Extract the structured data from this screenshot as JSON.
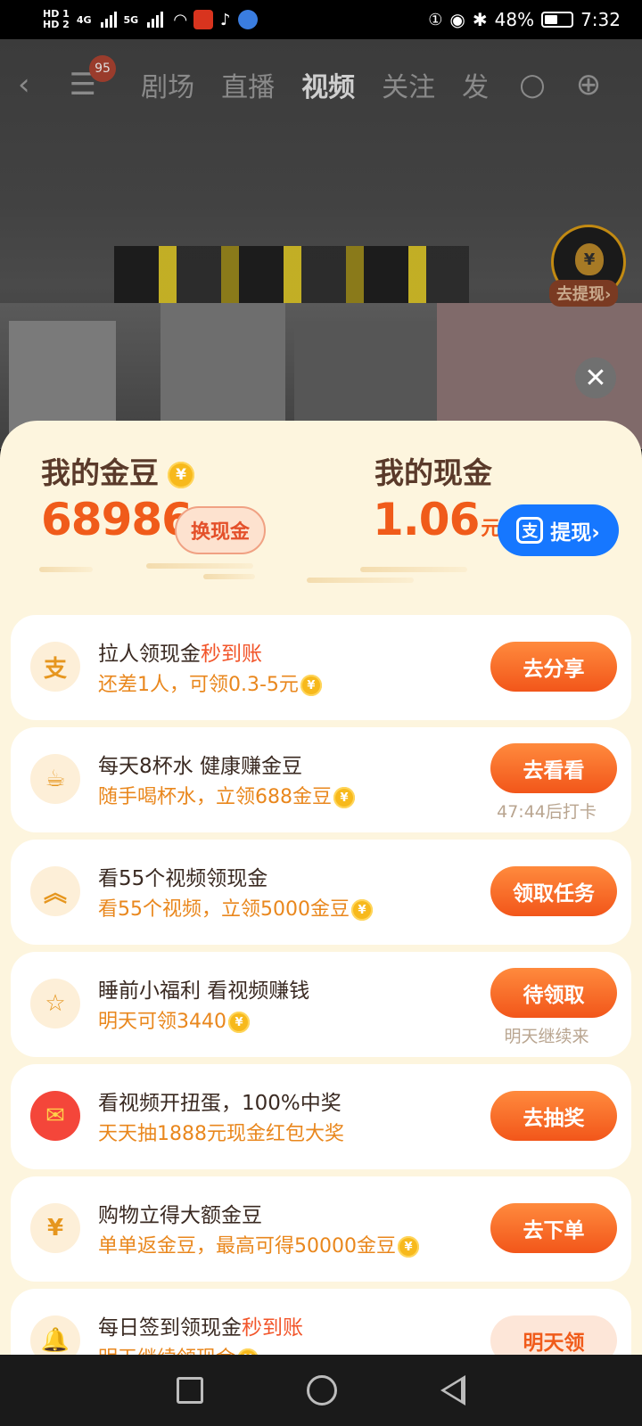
{
  "status_bar": {
    "hd1": "HD 1",
    "hd2": "HD 2",
    "net1": "4G",
    "net2": "5G",
    "battery": "48%",
    "time": "7:32"
  },
  "video_top": {
    "notification_count": "95",
    "tabs": [
      "剧场",
      "直播",
      "视频",
      "关注",
      "发"
    ],
    "active_tab": "视频",
    "withdraw_label": "去提现›",
    "coin_symbol": "¥"
  },
  "balance": {
    "beans_title": "我的金豆",
    "beans_value": "68986",
    "exchange_button": "换现金",
    "cash_title": "我的现金",
    "cash_value": "1.06",
    "cash_unit": "元",
    "withdraw_button": "提现›",
    "alipay_glyph": "支"
  },
  "tasks": [
    {
      "title": "拉人领现金",
      "title_highlight": "秒到账",
      "subtitle": "还差1人，可领0.3-5元",
      "coin": true,
      "button": "去分享",
      "note": "",
      "icon": "alipay-icon",
      "glyph": "支"
    },
    {
      "title": "每天8杯水 健康赚金豆",
      "title_highlight": "",
      "subtitle": "随手喝杯水，立领688金豆",
      "coin": true,
      "button": "去看看",
      "note": "47:44后打卡",
      "icon": "cup-icon",
      "glyph": "☕"
    },
    {
      "title": "看55个视频领现金",
      "title_highlight": "",
      "subtitle": "看55个视频，立领5000金豆",
      "coin": true,
      "button": "领取任务",
      "note": "",
      "icon": "double-chevron-up-icon",
      "glyph": "︽"
    },
    {
      "title": "睡前小福利 看视频赚钱",
      "title_highlight": "",
      "subtitle": "明天可领3440",
      "coin": true,
      "button": "待领取",
      "note": "明天继续来",
      "icon": "star-icon",
      "glyph": "☆"
    },
    {
      "title": "看视频开扭蛋，100%中奖",
      "title_highlight": "",
      "subtitle": "天天抽1888元现金红包大奖",
      "coin": false,
      "button": "去抽奖",
      "note": "",
      "icon": "red-envelope-icon",
      "glyph": "✉"
    },
    {
      "title": "购物立得大额金豆",
      "title_highlight": "",
      "subtitle": "单单返金豆，最高可得50000金豆",
      "coin": true,
      "button": "去下单",
      "note": "",
      "icon": "money-bag-icon",
      "glyph": "¥"
    },
    {
      "title": "每日签到领现金",
      "title_highlight": "秒到账",
      "subtitle": "明天继续领现金",
      "coin": true,
      "button": "明天领",
      "note": "",
      "icon": "bell-icon",
      "glyph": "🔔"
    }
  ],
  "colors": {
    "accent_orange": "#f05b1a",
    "sheet_bg": "#fdf5de",
    "alipay_blue": "#1677ff"
  }
}
